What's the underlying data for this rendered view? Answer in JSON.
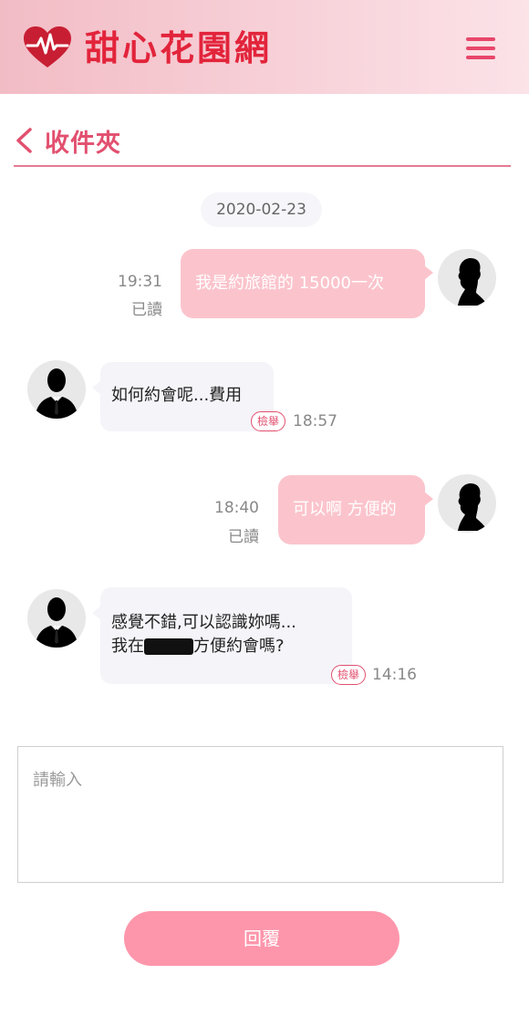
{
  "header": {
    "logo_text": "甜心花園網",
    "logo_icon": "heart-pulse-icon",
    "menu_icon": "hamburger-menu-icon"
  },
  "titlebar": {
    "title": "收件夾",
    "back_icon": "chevron-left-icon"
  },
  "conversation": {
    "date": "2020-02-23",
    "messages": [
      {
        "direction": "out",
        "text": "我是約旅館的 15000一次",
        "time": "19:31",
        "status": "已讀"
      },
      {
        "direction": "in",
        "text": "如何約會呢...費用",
        "time": "18:57",
        "report_label": "檢舉"
      },
      {
        "direction": "out",
        "text": "可以啊 方便的",
        "time": "18:40",
        "status": "已讀"
      },
      {
        "direction": "in",
        "line1": "感覺不錯,可以認識妳嗎...",
        "line2_prefix": "我在",
        "line2_suffix": "方便約會嗎?",
        "time": "14:16",
        "report_label": "檢舉"
      }
    ]
  },
  "reply": {
    "placeholder": "請輸入",
    "value": "",
    "button_label": "回覆"
  },
  "colors": {
    "brand": "#e2243b",
    "accent": "#e2506f",
    "bubble_out": "#fbc4cc",
    "bubble_in": "#f4f4f9",
    "button": "#fd96ab"
  }
}
